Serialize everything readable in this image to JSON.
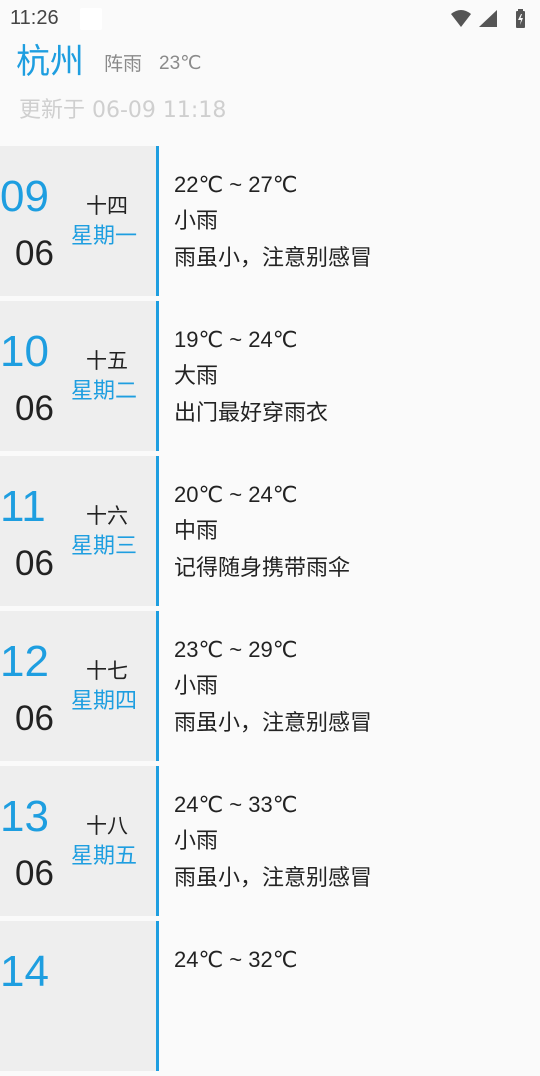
{
  "status_bar": {
    "time": "11:26",
    "icons": [
      "wifi-icon",
      "cellular-signal-icon",
      "battery-charging-icon"
    ]
  },
  "header": {
    "city": "杭州",
    "current_weather": "阵雨",
    "current_temp": "23℃",
    "updated": "更新于 06-09 11:18"
  },
  "colors": {
    "accent": "#1e9ee0",
    "date_block_bg": "#eeeeee",
    "background": "#fafafa",
    "text": "#222222",
    "muted": "#8a8a8a"
  },
  "forecast": [
    {
      "day": "09",
      "month": "06",
      "lunar": "十四",
      "weekday": "星期一",
      "temp_range": "22℃ ~ 27℃",
      "condition": "小雨",
      "advice": "雨虽小，注意别感冒"
    },
    {
      "day": "10",
      "month": "06",
      "lunar": "十五",
      "weekday": "星期二",
      "temp_range": "19℃ ~ 24℃",
      "condition": "大雨",
      "advice": "出门最好穿雨衣"
    },
    {
      "day": "11",
      "month": "06",
      "lunar": "十六",
      "weekday": "星期三",
      "temp_range": "20℃ ~ 24℃",
      "condition": "中雨",
      "advice": "记得随身携带雨伞"
    },
    {
      "day": "12",
      "month": "06",
      "lunar": "十七",
      "weekday": "星期四",
      "temp_range": "23℃ ~ 29℃",
      "condition": "小雨",
      "advice": "雨虽小，注意别感冒"
    },
    {
      "day": "13",
      "month": "06",
      "lunar": "十八",
      "weekday": "星期五",
      "temp_range": "24℃ ~ 33℃",
      "condition": "小雨",
      "advice": "雨虽小，注意别感冒"
    },
    {
      "day": "14",
      "month": "",
      "lunar": "",
      "weekday": "",
      "temp_range": "24℃ ~ 32℃",
      "condition": "",
      "advice": ""
    }
  ]
}
